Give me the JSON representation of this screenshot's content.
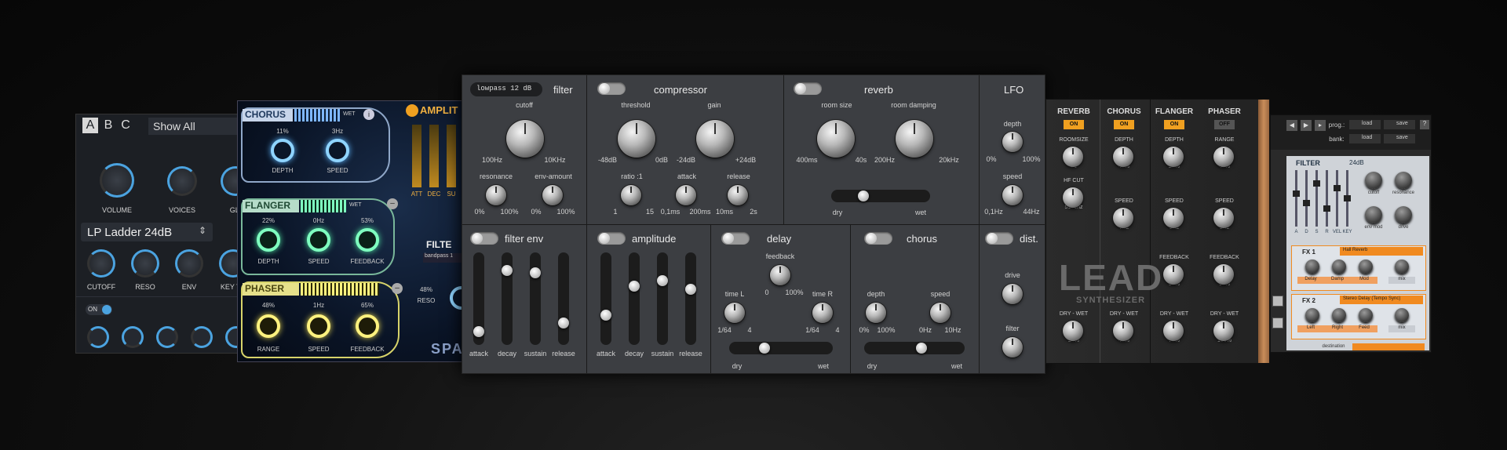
{
  "p1": {
    "tabs": [
      "A",
      "B",
      "C"
    ],
    "show_all": "Show All",
    "filter_select": "LP Ladder 24dB",
    "knob_labels_top": [
      "VOLUME",
      "VOICES",
      "GLI"
    ],
    "knob_labels_mid": [
      "CUTOFF",
      "RESO",
      "ENV",
      "KEY TR"
    ],
    "on": "ON"
  },
  "p2": {
    "chorus": "CHORUS",
    "flanger": "FLANGER",
    "phaser": "PHASER",
    "wet": "WET",
    "chorus_vals": [
      "11%",
      "3Hz"
    ],
    "chorus_labels": [
      "DEPTH",
      "SPEED"
    ],
    "flanger_vals": [
      "22%",
      "0Hz",
      "53%"
    ],
    "flanger_labels": [
      "DEPTH",
      "SPEED",
      "FEEDBACK"
    ],
    "phaser_vals": [
      "48%",
      "1Hz",
      "65%"
    ],
    "phaser_labels": [
      "RANGE",
      "SPEED",
      "FEEDBACK"
    ],
    "amplitude": "AMPLIT",
    "env_labels": [
      "ATT",
      "DEC",
      "SU"
    ],
    "filter": "FILTE",
    "filter_select": "bandpass 1",
    "reso_val": "48%",
    "reso": "RESO",
    "spa": "SPA"
  },
  "p3": {
    "filter": {
      "select": "lowpass 12 dB",
      "title": "filter",
      "cutoff": "cutoff",
      "min": "100Hz",
      "max": "10KHz",
      "resonance": "resonance",
      "reso_min": "0%",
      "reso_max": "100%",
      "env_amount": "env-amount",
      "env_min": "0%",
      "env_max": "100%"
    },
    "compressor": {
      "title": "compressor",
      "threshold": "threshold",
      "thr_min": "-48dB",
      "thr_max": "0dB",
      "gain": "gain",
      "gain_min": "-24dB",
      "gain_max": "+24dB",
      "ratio": "ratio :1",
      "ratio_min": "1",
      "ratio_max": "15",
      "attack": "attack",
      "att_min": "0,1ms",
      "att_max": "200ms",
      "release": "release",
      "rel_min": "10ms",
      "rel_max": "2s"
    },
    "reverb": {
      "title": "reverb",
      "room_size": "room size",
      "rs_min": "400ms",
      "rs_max": "40s",
      "room_damping": "room damping",
      "rd_min": "200Hz",
      "rd_max": "20kHz",
      "dry": "dry",
      "wet": "wet"
    },
    "lfo": {
      "title": "LFO",
      "depth": "depth",
      "d_min": "0%",
      "d_max": "100%",
      "speed": "speed",
      "s_min": "0,1Hz",
      "s_max": "44Hz"
    },
    "filter_env": {
      "title": "filter env",
      "labels": [
        "attack",
        "decay",
        "sustain",
        "release"
      ],
      "levels": [
        0.1,
        0.85,
        0.82,
        0.2
      ]
    },
    "amplitude": {
      "title": "amplitude",
      "labels": [
        "attack",
        "decay",
        "sustain",
        "release"
      ],
      "levels": [
        0.3,
        0.65,
        0.72,
        0.62
      ]
    },
    "delay": {
      "title": "delay",
      "feedback": "feedback",
      "fb_min": "0",
      "fb_max": "100%",
      "time_l": "time L",
      "tl_min": "1/64",
      "tl_max": "4",
      "time_r": "time R",
      "tr_min": "1/64",
      "tr_max": "4",
      "dry": "dry",
      "wet": "wet"
    },
    "chorus": {
      "title": "chorus",
      "depth": "depth",
      "d_min": "0%",
      "d_max": "100%",
      "speed": "speed",
      "s_min": "0Hz",
      "s_max": "10Hz",
      "dry": "dry",
      "wet": "wet"
    },
    "dist": {
      "title": "dist.",
      "drive": "drive",
      "filter": "filter"
    }
  },
  "p4": {
    "heads": [
      "REVERB",
      "CHORUS",
      "FLANGER",
      "PHASER"
    ],
    "toggles": [
      "ON",
      "ON",
      "ON",
      "OFF"
    ],
    "col1": [
      "ROOMSIZE",
      "5s",
      "HF CUT",
      "5130hz",
      "DRY - WET",
      "24%"
    ],
    "col2": [
      "DEPTH",
      "41%",
      "SPEED",
      "7Hz",
      "DRY - WET",
      "41%"
    ],
    "col3": [
      "DEPTH",
      "22%",
      "SPEED",
      "0Hz",
      "FEEDBACK",
      "53%",
      "DRY - WET",
      "70%"
    ],
    "col4": [
      "RANGE",
      "48%",
      "SPEED",
      "1Hz",
      "FEEDBACK",
      "65%",
      "DRY - WET",
      "100%"
    ],
    "logo": "LEAD",
    "logo_sub": "SYNTHESIZER"
  },
  "p5": {
    "prog": "prog.:",
    "bank": "bank:",
    "load": "load",
    "save": "save",
    "help": "?",
    "filter": "FILTER",
    "db": "24dB",
    "env_letters": [
      "A",
      "D",
      "S",
      "R",
      "VEL",
      "KEY"
    ],
    "knob_labels": [
      "cutoff",
      "resonance",
      "env mod",
      "drive"
    ],
    "fx1": "FX 1",
    "fx1_sel": "Hall Reverb",
    "fx1_params": [
      "Delay",
      "Damp",
      "Mod",
      "mix"
    ],
    "fx2": "FX 2",
    "fx2_sel": "Stereo Delay (Tempo Sync)",
    "fx2_params": [
      "Left",
      "Right",
      "Feed",
      "mix"
    ],
    "destination": "destination"
  }
}
